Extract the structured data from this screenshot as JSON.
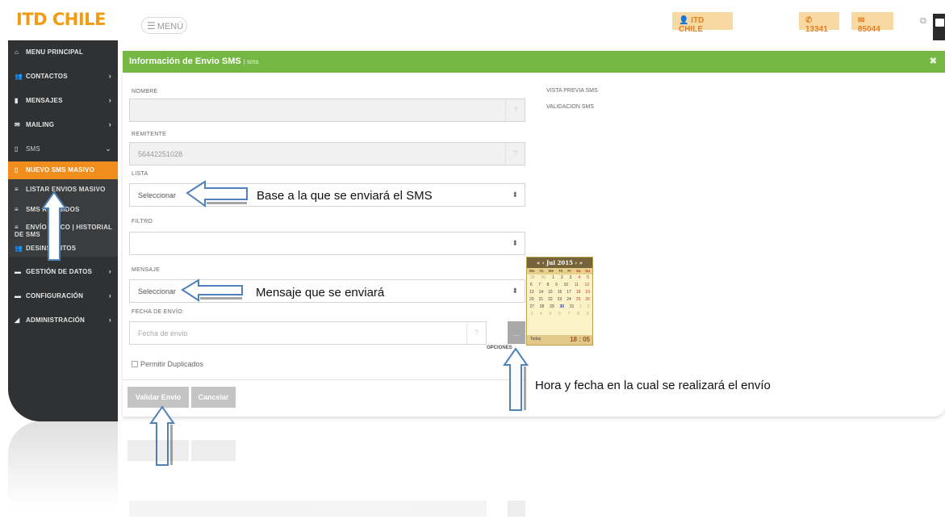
{
  "topbar": {
    "brand": "ITD CHILE",
    "menu_label": "MENÚ",
    "user_badge": "ITD CHILE",
    "phone_badge": "13341",
    "mail_badge": "85044"
  },
  "sidebar": {
    "items": [
      {
        "label": "MENU PRINCIPAL",
        "icon": "bank-icon",
        "chevron": ""
      },
      {
        "label": "CONTACTOS",
        "icon": "users-icon",
        "chevron": "›"
      },
      {
        "label": "MENSAJES",
        "icon": "file-icon",
        "chevron": "›"
      },
      {
        "label": "MAILING",
        "icon": "envelope-icon",
        "chevron": "›"
      },
      {
        "label": "SMS",
        "icon": "mobile-icon",
        "chevron": "⌄"
      },
      {
        "label": "NUEVO SMS MASIVO",
        "icon": "mobile-icon",
        "chevron": ""
      },
      {
        "label": "LISTAR ENVIOS MASIVO",
        "icon": "list-icon",
        "chevron": ""
      },
      {
        "label": "SMS RECIBIDOS",
        "icon": "list-icon",
        "chevron": ""
      },
      {
        "label": "ENVÍO ÚNICO | HISTORIAL DE SMS",
        "icon": "list-icon",
        "chevron": ""
      },
      {
        "label": "DESINSCRITOS",
        "icon": "users-icon",
        "chevron": ""
      },
      {
        "label": "GESTIÓN DE DATOS",
        "icon": "comment-icon",
        "chevron": "›"
      },
      {
        "label": "CONFIGURACIÓN",
        "icon": "comment-icon",
        "chevron": "›"
      },
      {
        "label": "ADMINISTRACIÓN",
        "icon": "chart-icon",
        "chevron": "›"
      }
    ]
  },
  "panel": {
    "title": "Información de Envio SMS",
    "subtitle": "| sms",
    "close_icon": "close-icon"
  },
  "form": {
    "nombre_label": "NOMBRE",
    "nombre_value": "",
    "remitente_label": "REMITENTE",
    "remitente_value": "56442251028",
    "lista_label": "LISTA",
    "lista_value": "Seleccionar",
    "filtro_label": "FILTRO",
    "filtro_value": "",
    "mensaje_label": "MENSAJE",
    "mensaje_value": "Seleccionar",
    "fecha_label": "FECHA DE ENVÍO:",
    "fecha_placeholder": "Fecha de envio",
    "help_glyph": "?",
    "dots_label": "...",
    "opciones_label": "OPCIONES",
    "permitir_label": "Permitir Duplicados",
    "validar_label": "Validar Envio",
    "cancelar_label": "Cancelar"
  },
  "right": {
    "vista_previa": "VISTA PREVIA SMS",
    "validacion": "VALIDACION SMS"
  },
  "calendar": {
    "month": "Jul 2015",
    "nav_prev": "« ‹",
    "nav_next": "› »",
    "days": [
      "Mo",
      "Tu",
      "We",
      "Th",
      "Fr",
      "Sa",
      "Su"
    ],
    "weeks": [
      [
        "29",
        "30",
        "1",
        "2",
        "3",
        "4",
        "5"
      ],
      [
        "6",
        "7",
        "8",
        "9",
        "10",
        "11",
        "12"
      ],
      [
        "13",
        "14",
        "15",
        "16",
        "17",
        "18",
        "19"
      ],
      [
        "20",
        "21",
        "22",
        "23",
        "24",
        "25",
        "26"
      ],
      [
        "27",
        "28",
        "29",
        "30",
        "31",
        "1",
        "2"
      ],
      [
        "3",
        "4",
        "5",
        "6",
        "7",
        "8",
        "9"
      ]
    ],
    "today_label": "Today",
    "time": "18 : 05"
  },
  "annotations": {
    "lista_note": "Base a la que se enviará el SMS",
    "mensaje_note": "Mensaje que se enviará",
    "fecha_note": "Hora y fecha en la cual se realizará el envío"
  },
  "colors": {
    "accent_orange": "#f18d1c",
    "header_green": "#75b743",
    "sidebar_dark": "#2f3133",
    "arrow_blue": "#4f81bd"
  }
}
